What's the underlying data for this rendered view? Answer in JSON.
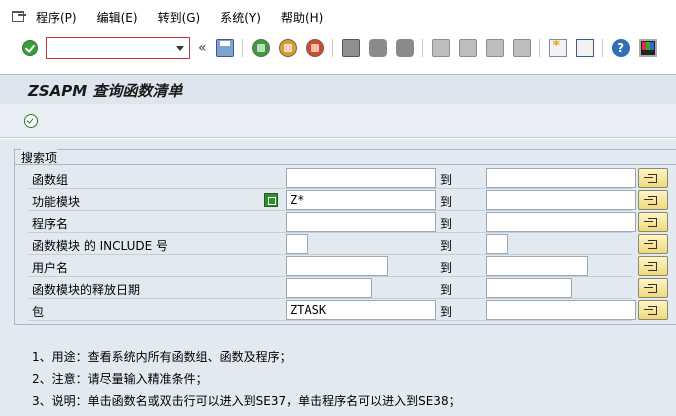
{
  "menubar": {
    "items": [
      "程序(P)",
      "编辑(E)",
      "转到(G)",
      "系统(Y)",
      "帮助(H)"
    ]
  },
  "toolbar": {
    "command_field_value": "",
    "icons": [
      "ok-icon",
      "save-icon",
      "back-icon",
      "exit-icon",
      "cancel-icon",
      "print-icon",
      "find-icon",
      "find-next-icon",
      "first-page-icon",
      "prev-page-icon",
      "next-page-icon",
      "last-page-icon",
      "create-session-icon",
      "shortcut-icon",
      "help-icon",
      "customize-layout-icon"
    ]
  },
  "page": {
    "title": "ZSAPM 查询函数清单"
  },
  "search": {
    "group_title": "搜索项",
    "to_label": "到",
    "rows": [
      {
        "label": "函数组",
        "from": "",
        "to": ""
      },
      {
        "label": "功能模块",
        "from": "Z*",
        "to": ""
      },
      {
        "label": "程序名",
        "from": "",
        "to": ""
      },
      {
        "label": "函数模块 的 INCLUDE 号",
        "from": "",
        "to": ""
      },
      {
        "label": "用户名",
        "from": "",
        "to": ""
      },
      {
        "label": "函数模块的释放日期",
        "from": "",
        "to": ""
      },
      {
        "label": "包",
        "from": "ZTASK",
        "to": ""
      }
    ]
  },
  "notes": [
    "1、用途：查看系统内所有函数组、函数及程序；",
    "2、注意：请尽量输入精准条件；",
    "3、说明：单击函数名或双击行可以进入到SE37，单击程序名可以进入到SE38；"
  ],
  "colors": {
    "title_bg": "#dde6ef",
    "main_bg": "#e2e9f0",
    "command_field_border": "#cc3333"
  }
}
